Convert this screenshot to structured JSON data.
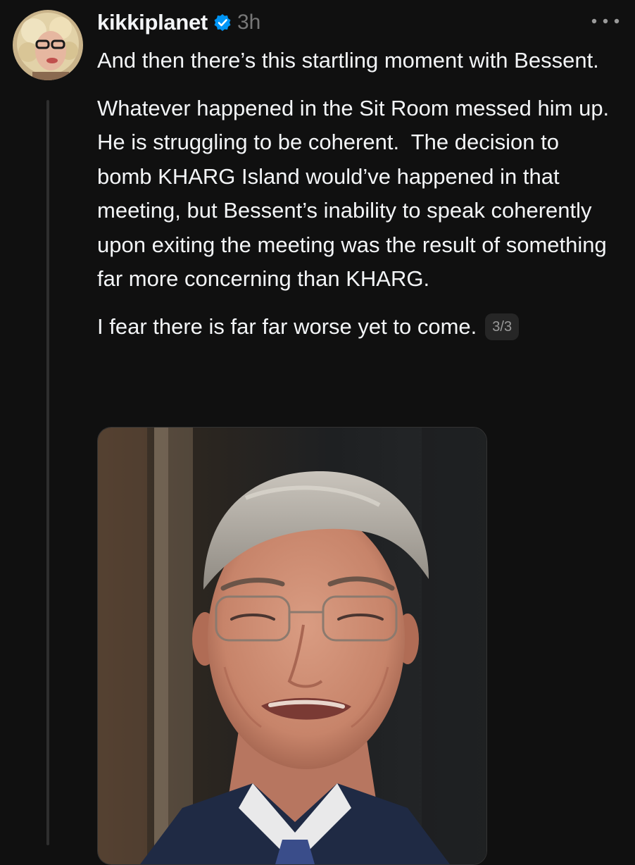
{
  "post": {
    "username": "kikkiplanet",
    "verified": true,
    "time": "3h",
    "more_menu_icon": "more-horizontal-icon",
    "paragraphs": [
      "And then there’s this startling moment with Bessent.",
      "Whatever happened in the Sit Room messed him up. He is struggling to be coherent.  The decision to bomb KHARG Island would’ve happened in that meeting, but Bessent’s inability to speak coherently upon exiting the meeting was the result of something far more concerning than KHARG.",
      "I fear there is far far worse yet to come."
    ],
    "thread_counter": "3/3"
  },
  "colors": {
    "background": "#101010",
    "text": "#f3f5f7",
    "muted": "#777777",
    "verified_badge": "#0095f6"
  }
}
